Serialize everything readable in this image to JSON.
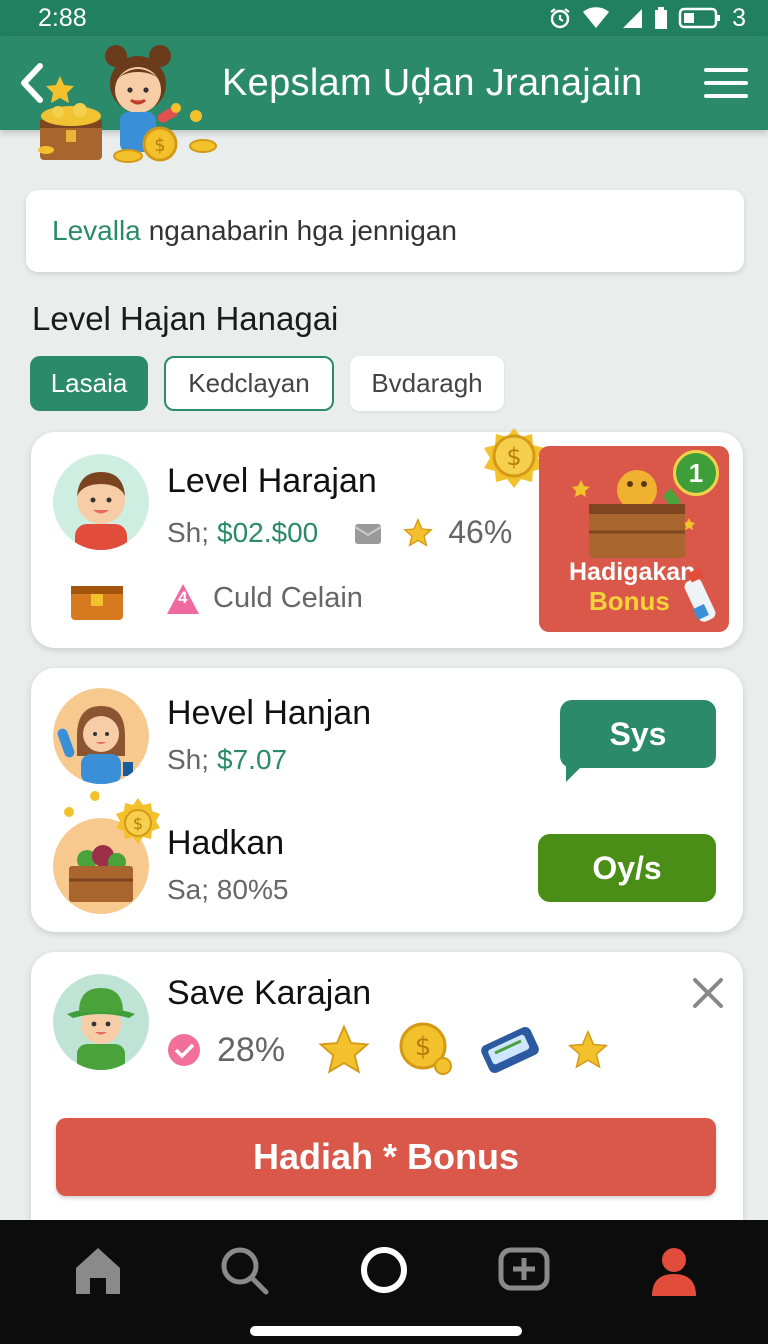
{
  "status": {
    "time": "2:88",
    "battery_label": "3"
  },
  "header": {
    "title": "Kepslam Uḑan Jranajain"
  },
  "search": {
    "highlight": "Levalla",
    "text": "nganabarin hga jennigan"
  },
  "section": {
    "title": "Level Hajan Hanagai"
  },
  "tabs": [
    {
      "label": "Lasaia",
      "state": "active"
    },
    {
      "label": "Kedclayan",
      "state": "outline"
    },
    {
      "label": "Bvdaragh",
      "state": "plain"
    }
  ],
  "card1": {
    "name": "Level Harajan",
    "prefix": "Sh;",
    "amount": "$02.$00",
    "percent": "46%",
    "badge_number": "4",
    "extra": "Culd Celain",
    "bonus": {
      "count": "1",
      "line1": "Hadigakan",
      "line2": "Bonus"
    }
  },
  "card2": {
    "row1": {
      "name": "Hevel Hanjan",
      "prefix": "Sh;",
      "amount": "$7.07",
      "button": "Sys"
    },
    "row2": {
      "name": "Hadkan",
      "sub": "Sa; 80%5",
      "button": "Oy/s"
    }
  },
  "card3": {
    "name": "Save Karajan",
    "percent": "28%",
    "button": "Hadiah * Bonus"
  },
  "colors": {
    "primary": "#2a8a6a",
    "bonus_red": "#d9584a",
    "green_button": "#4a8e17",
    "gold": "#f3c12c"
  },
  "nav": [
    "home-icon",
    "search-icon",
    "circle-icon",
    "add-chat-icon",
    "profile-icon"
  ]
}
